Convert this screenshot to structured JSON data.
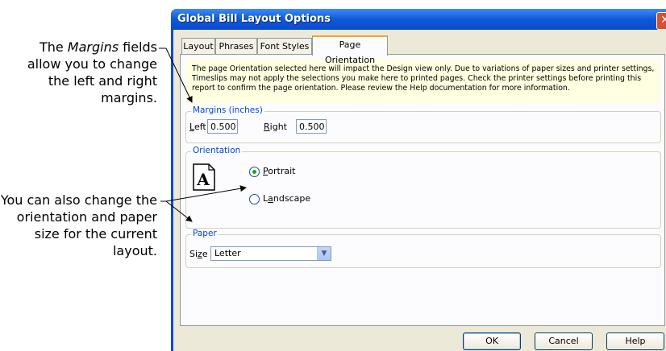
{
  "callouts": {
    "margins": {
      "prefix": "The ",
      "emphasis": "Margins",
      "suffix": " fields allow you to change the left and right margins."
    },
    "orientation": {
      "text": "You can also change the orientation and paper size for the current layout."
    }
  },
  "dialog": {
    "title": "Global Bill Layout Options",
    "close_glyph": "✕",
    "tabs": [
      {
        "label": "Layout"
      },
      {
        "label": "Phrases"
      },
      {
        "label": "Font Styles"
      },
      {
        "label": "Page Orientation"
      }
    ],
    "active_tab": "Page Orientation",
    "info_text": "The page Orientation selected here will impact the Design view only. Due to variations of paper sizes and printer settings, Timeslips may not apply the selections you make here to printed pages. Check the printer settings before printing this report to confirm the page orientation. Please review the Help documentation for more information.",
    "margins": {
      "group_label": "Margins (inches)",
      "left_label_u": "L",
      "left_label_rest": "eft",
      "left_value": "0.500",
      "right_label_u": "R",
      "right_label_rest": "ight",
      "right_value": "0.500"
    },
    "orientation": {
      "group_label": "Orientation",
      "page_icon_letter": "A",
      "portrait_u": "P",
      "portrait_rest": "ortrait",
      "landscape_pre": "L",
      "landscape_u": "a",
      "landscape_rest": "ndscape",
      "selected": "Portrait"
    },
    "paper": {
      "group_label": "Paper",
      "size_pre": "Si",
      "size_u": "z",
      "size_rest": "e",
      "size_value": "Letter"
    },
    "buttons": {
      "ok": "OK",
      "cancel": "Cancel",
      "help": "Help"
    }
  },
  "colors": {
    "title_bar": "#1058d8",
    "dialog_face": "#ece9d8",
    "info_background": "#ffffe1",
    "group_label": "#0046d5"
  }
}
